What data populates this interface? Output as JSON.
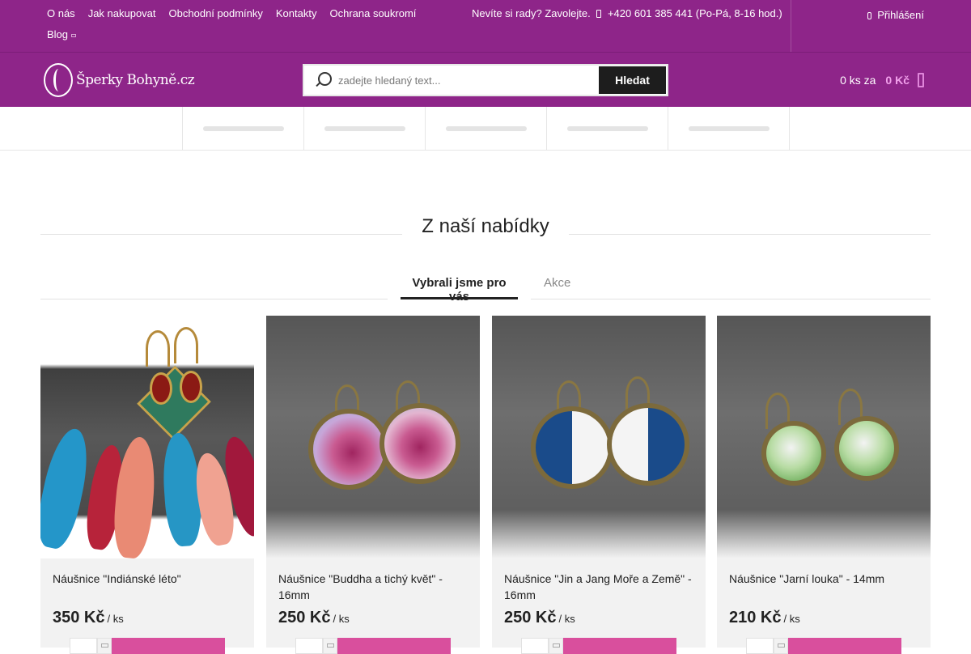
{
  "topbar": {
    "links": [
      "O nás",
      "Jak nakupovat",
      "Obchodní podmínky",
      "Kontakty",
      "Ochrana soukromí"
    ],
    "blog_label": "Blog",
    "contact_text": "Nevíte si rady? Zavolejte.",
    "phone": "+420 601 385 441",
    "hours": "(Po-Pá, 8-16 hod.)",
    "login_label": "Přihlášení"
  },
  "header": {
    "logo_text": "Šperky Bohyně.cz",
    "search_placeholder": "zadejte hledaný text...",
    "search_button": "Hledat",
    "cart_count": "0 ks za",
    "cart_price": "0 Kč"
  },
  "section": {
    "title": "Z naší nabídky",
    "tabs": [
      "Vybrali jsme pro vás",
      "Akce"
    ]
  },
  "products": [
    {
      "title": "Náušnice \"Indiánské léto\"",
      "price": "350 Kč",
      "unit": "/ ks"
    },
    {
      "title": "Náušnice \"Buddha a tichý květ\" - 16mm",
      "price": "250 Kč",
      "unit": "/ ks"
    },
    {
      "title": "Náušnice \"Jin a Jang Moře a Země\" - 16mm",
      "price": "250 Kč",
      "unit": "/ ks"
    },
    {
      "title": "Náušnice \"Jarní louka\" - 14mm",
      "price": "210 Kč",
      "unit": "/ ks"
    }
  ],
  "colors": {
    "brand_purple": "#8e2589",
    "cart_accent": "#f2a1ec",
    "buy_button": "#d94f9d"
  },
  "icons": [
    "phone-icon",
    "user-icon",
    "search-icon",
    "bag-icon",
    "chevron-down-icon"
  ]
}
